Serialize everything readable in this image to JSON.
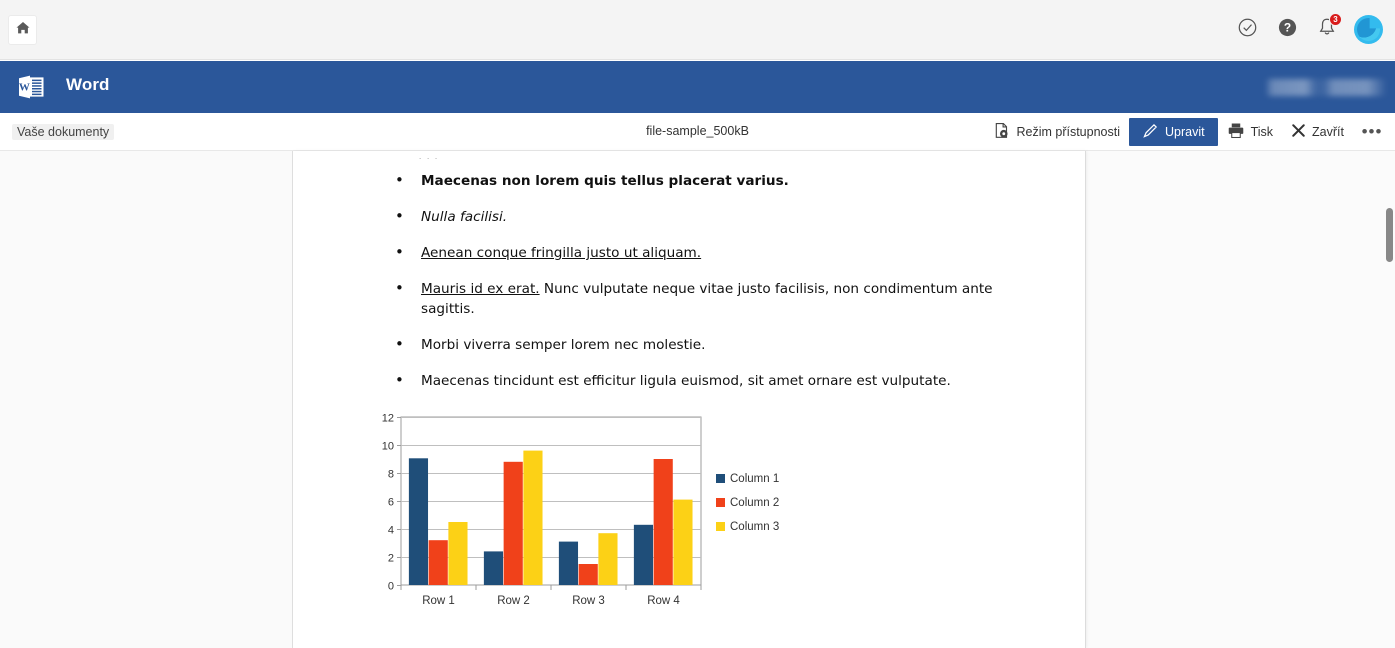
{
  "topbar": {
    "home_icon": "home-icon",
    "icons": [
      {
        "name": "check-circle-icon",
        "label": ""
      },
      {
        "name": "help-question-icon",
        "label": ""
      },
      {
        "name": "notification-bell-icon",
        "label": "",
        "badge": "3"
      }
    ],
    "avatar_name": "user-avatar"
  },
  "appbar": {
    "logo_name": "word-logo-icon",
    "title": "Word",
    "account_text_redacted": ""
  },
  "commandbar": {
    "breadcrumb": "Vaše dokumenty",
    "document_name": "file-sample_500kB",
    "buttons": [
      {
        "name": "accessibility-mode-button",
        "label": "Režim přístupnosti",
        "icon": "accessibility-doc-icon"
      },
      {
        "name": "edit-button",
        "label": "Upravit",
        "icon": "pencil-icon"
      },
      {
        "name": "print-button",
        "label": "Tisk",
        "icon": "printer-icon"
      },
      {
        "name": "close-button",
        "label": "Zavřít",
        "icon": "close-x-icon"
      }
    ],
    "overflow_label": "•••"
  },
  "document": {
    "clipped_line": "· · ·",
    "bullets": [
      {
        "style": "bold",
        "text": "Maecenas non lorem quis tellus placerat varius."
      },
      {
        "style": "italic",
        "text": "Nulla facilisi."
      },
      {
        "style": "underline",
        "text": "Aenean conque fringilla justo ut aliquam."
      },
      {
        "style": "mixed",
        "lead": "Mauris id ex erat.",
        "text": " Nunc vulputate neque vitae justo facilisis, non condimentum ante sagittis."
      },
      {
        "style": "plain",
        "text": "Morbi viverra semper lorem nec molestie."
      },
      {
        "style": "plain",
        "text": "Maecenas tincidunt est efficitur ligula euismod, sit amet ornare est vulputate."
      }
    ]
  },
  "chart_data": {
    "type": "bar",
    "title": "",
    "xlabel": "",
    "ylabel": "",
    "categories": [
      "Row 1",
      "Row 2",
      "Row 3",
      "Row 4"
    ],
    "series": [
      {
        "name": "Column 1",
        "color": "#1F4E79",
        "values": [
          9.05,
          2.4,
          3.1,
          4.3
        ]
      },
      {
        "name": "Column 2",
        "color": "#F0411A",
        "values": [
          3.2,
          8.8,
          1.5,
          9.0
        ]
      },
      {
        "name": "Column 3",
        "color": "#FCD116",
        "values": [
          4.5,
          9.6,
          3.7,
          6.1
        ]
      }
    ],
    "ylim": [
      0,
      12
    ],
    "yticks": [
      0,
      2,
      4,
      6,
      8,
      10,
      12
    ],
    "grid": true,
    "legend_position": "right"
  },
  "scrollbar": {
    "name": "vertical-scrollbar"
  }
}
